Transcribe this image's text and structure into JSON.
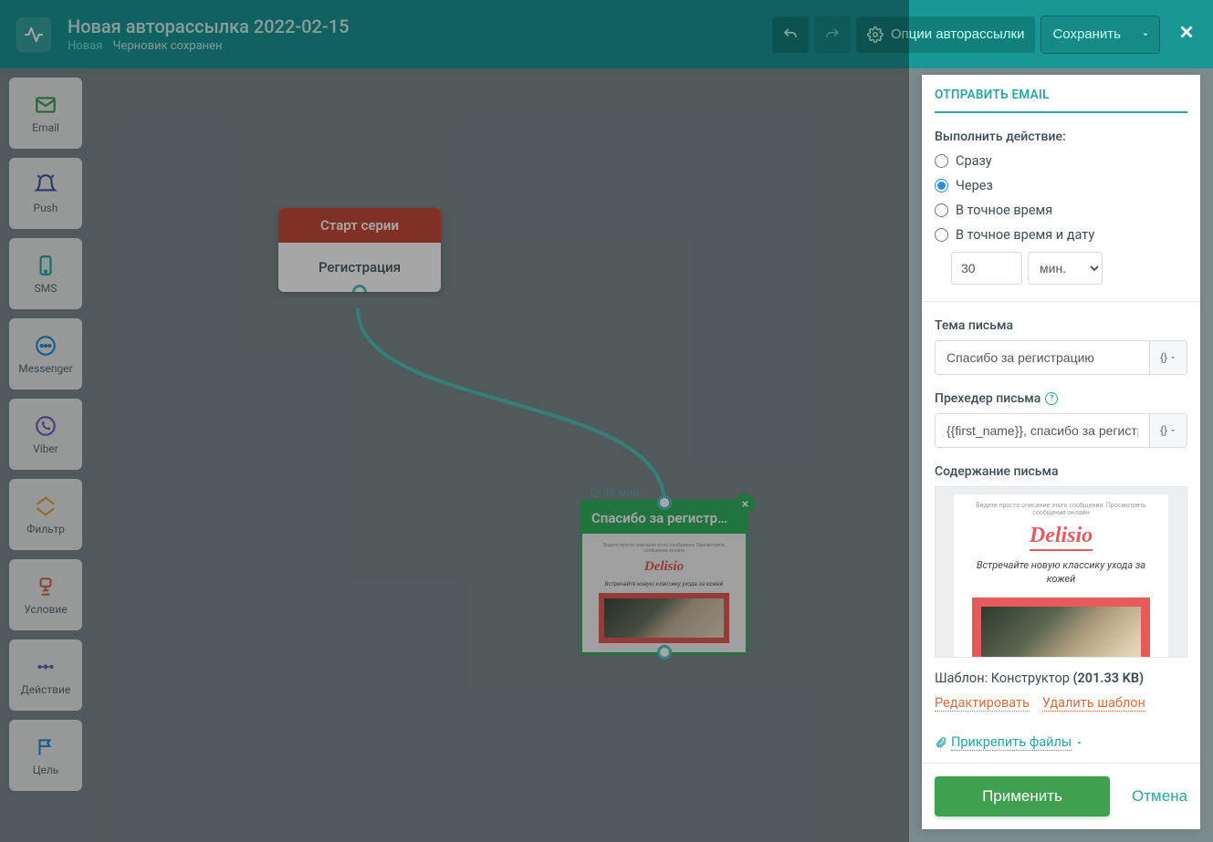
{
  "header": {
    "title": "Новая авторассылка 2022-02-15",
    "status_new": "Новая",
    "status_saved": "Черновик сохранен",
    "options_btn": "Опции авторассылки",
    "save_btn": "Сохранить"
  },
  "sidebar": {
    "items": [
      {
        "label": "Email",
        "icon": "mail-icon",
        "color": "#3fa04f"
      },
      {
        "label": "Push",
        "icon": "bell-icon",
        "color": "#3d5aa8"
      },
      {
        "label": "SMS",
        "icon": "phone-icon",
        "color": "#23a8a4"
      },
      {
        "label": "Messenger",
        "icon": "chat-icon",
        "color": "#2a8fd4"
      },
      {
        "label": "Viber",
        "icon": "viber-icon",
        "color": "#7360c4"
      },
      {
        "label": "Фильтр",
        "icon": "filter-icon",
        "color": "#e6a43c"
      },
      {
        "label": "Условие",
        "icon": "condition-icon",
        "color": "#d46a5a"
      },
      {
        "label": "Действие",
        "icon": "action-icon",
        "color": "#7360c4"
      },
      {
        "label": "Цель",
        "icon": "goal-icon",
        "color": "#2a8fd4"
      }
    ]
  },
  "nodes": {
    "start": {
      "header": "Старт серии",
      "body": "Регистрация"
    },
    "email": {
      "title": "Спасибо за регистр…",
      "timer": "30 мин."
    }
  },
  "preview": {
    "hint": "Видите просто описание этого сообщения. Просмотреть сообщение онлайн",
    "brand": "Delisio",
    "tagline": "Встречайте новую классику ухода за кожей"
  },
  "panel": {
    "title": "ОТПРАВИТЬ EMAIL",
    "action_label": "Выполнить действие:",
    "radios": {
      "now": "Сразу",
      "after": "Через",
      "exact_time": "В точное время",
      "exact_datetime": "В точное время и дату"
    },
    "delay_value": "30",
    "delay_unit": "мин.",
    "subject_label": "Тема письма",
    "subject_value": "Спасибо за регистрацию",
    "preheader_label": "Прехедер письма",
    "preheader_value": "{{first_name}}, спасибо за регистра",
    "content_label": "Содержание письма",
    "template_prefix": "Шаблон:",
    "template_name": "Конструктор",
    "template_size": "(201.33 KB)",
    "edit_link": "Редактировать",
    "delete_link": "Удалить шаблон",
    "attach_link": "Прикрепить файлы",
    "vars_btn": "{} ",
    "apply_btn": "Применить",
    "cancel_btn": "Отмена"
  }
}
